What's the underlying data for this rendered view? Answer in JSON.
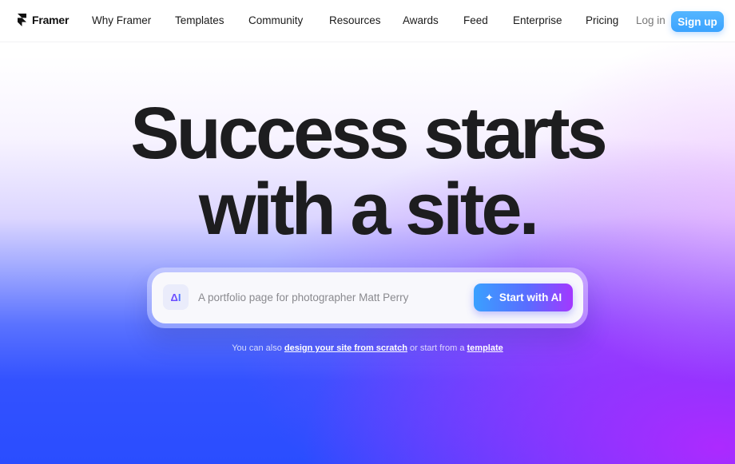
{
  "nav": {
    "brand": "Framer",
    "items": [
      {
        "label": "Why Framer"
      },
      {
        "label": "Templates"
      },
      {
        "label": "Community"
      },
      {
        "label": "Resources"
      },
      {
        "label": "Awards"
      },
      {
        "label": "Feed"
      },
      {
        "label": "Enterprise"
      },
      {
        "label": "Pricing"
      }
    ],
    "login_label": "Log in",
    "signup_label": "Sign up"
  },
  "hero": {
    "headline_line1": "Success starts",
    "headline_line2": "with a site.",
    "prompt": {
      "icon_label_triangle": "Δ",
      "icon_label_bar": "I",
      "placeholder": "A portfolio page for photographer Matt Perry",
      "value": ""
    },
    "start_button_label": "Start with AI",
    "sub_prefix": "You can also",
    "sub_link1": "design your site from scratch",
    "sub_middle": "or start from a",
    "sub_link2": "template"
  },
  "colors": {
    "signup_bg": "#3aa3ff",
    "start_gradient_from": "#3aa0ff",
    "start_gradient_to": "#a338ff",
    "headline": "#1d1d1f",
    "bg_bottom_left": "#2a4dff",
    "bg_bottom_right": "#b228ff"
  }
}
